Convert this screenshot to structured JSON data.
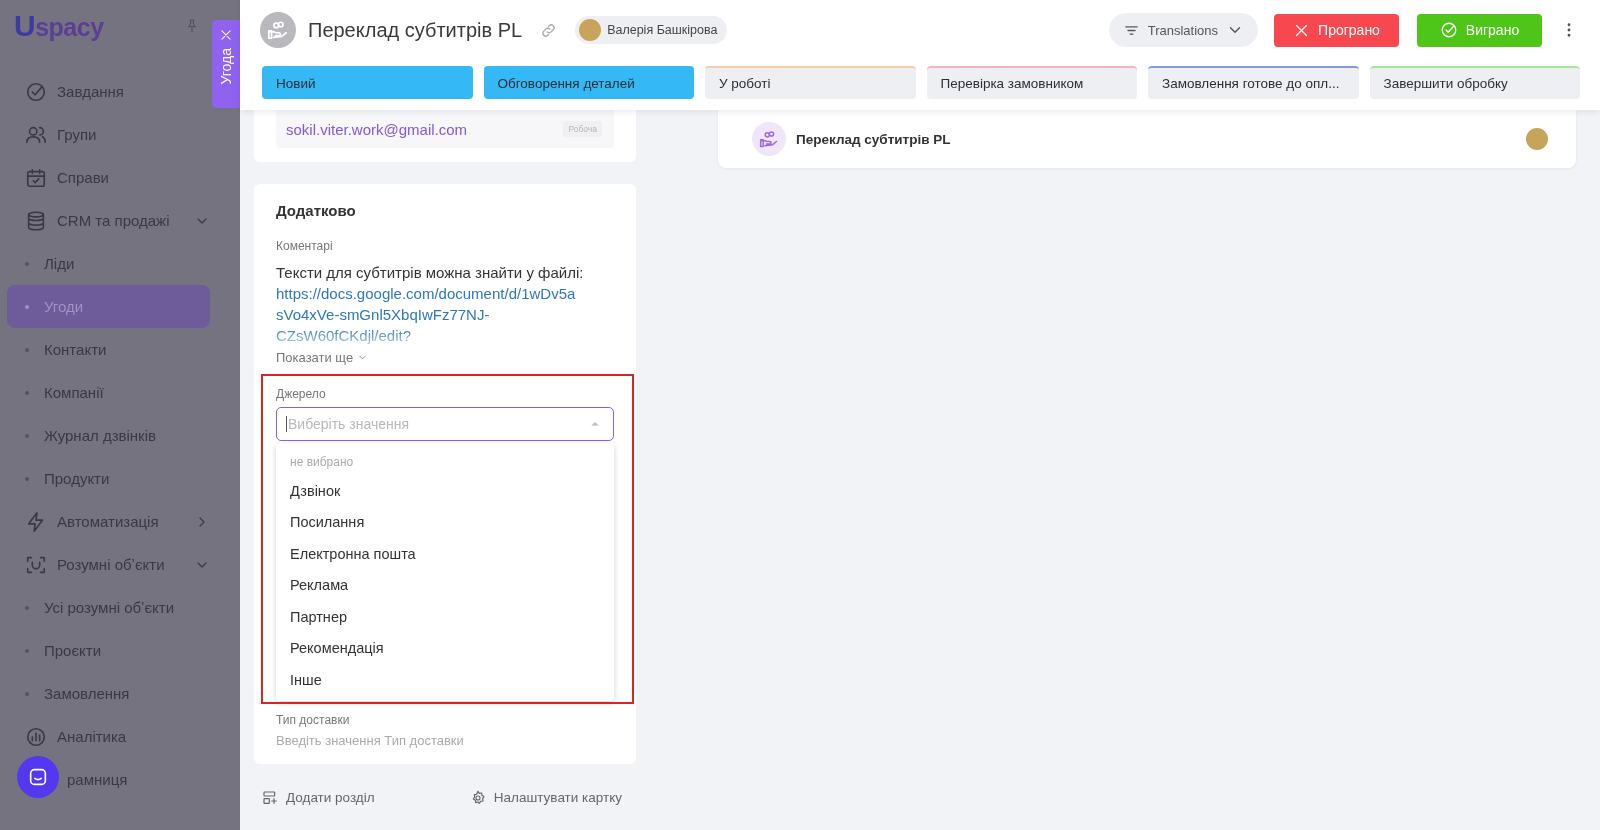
{
  "tab_handle": {
    "label": "Угода"
  },
  "sidebar": {
    "logo": "Uspacy",
    "items": [
      {
        "kind": "item",
        "label": "Завдання",
        "selected": false
      },
      {
        "kind": "item",
        "label": "Групи",
        "selected": false
      },
      {
        "kind": "item",
        "label": "Справи",
        "selected": false
      },
      {
        "kind": "group",
        "label": "CRM та продажі",
        "selected": false,
        "expanded": true,
        "children": [
          {
            "label": "Ліди",
            "selected": false
          },
          {
            "label": "Угоди",
            "selected": true
          },
          {
            "label": "Контакти",
            "selected": false
          },
          {
            "label": "Компанії",
            "selected": false
          },
          {
            "label": "Журнал дзвінків",
            "selected": false
          },
          {
            "label": "Продукти",
            "selected": false
          }
        ]
      },
      {
        "kind": "group",
        "label": "Автоматизація",
        "selected": false,
        "expanded": false
      },
      {
        "kind": "group",
        "label": "Розумні обʼєкти",
        "selected": false,
        "expanded": true,
        "children": [
          {
            "label": "Усі розумні обʼєкти",
            "selected": false
          },
          {
            "label": "Проєкти",
            "selected": false
          },
          {
            "label": "Замовлення",
            "selected": false
          }
        ]
      },
      {
        "kind": "item",
        "label": "Аналітика",
        "selected": false
      },
      {
        "kind": "partial",
        "label": "рамниця",
        "selected": false
      }
    ]
  },
  "header": {
    "title": "Переклад субтитрів PL",
    "responsible": "Валерія Башкірова",
    "pipeline": "Translations",
    "lose_button": "Програно",
    "win_button": "Виграно",
    "stages": [
      {
        "label": "Новий",
        "color": "#35b9f5",
        "done": true
      },
      {
        "label": "Обговорення деталей",
        "color": "#35b9f5",
        "done": true
      },
      {
        "label": "У роботі",
        "color": "#f5cba8",
        "done": false
      },
      {
        "label": "Перевірка замовником",
        "color": "#f2b5bd",
        "done": false
      },
      {
        "label": "Замовлення готове до опл...",
        "color": "#7f9fd6",
        "done": false
      },
      {
        "label": "Завершити обробку",
        "color": "#a8e6a0",
        "done": false
      }
    ]
  },
  "contact_card": {
    "email": "sokil.viter.work@gmail.com",
    "email_type": "Робоча"
  },
  "extra_card": {
    "title": "Додатково",
    "comment_label": "Коментарі",
    "comment_text": "Тексти для субтитрів можна знайти у файлі:",
    "comment_link": "https://docs.google.com/document/d/1wDv5asVo4xVe-smGnl5XbqIwFz77NJ-CZsW60fCKdjl/edit?",
    "show_more": "Показати ще",
    "source": {
      "label": "Джерело",
      "placeholder": "Виберіть значення",
      "expanded": true,
      "options": [
        {
          "kind": "empty",
          "label": "не вибрано",
          "selected": false
        },
        {
          "kind": "option",
          "label": "Дзвінок",
          "selected": false
        },
        {
          "kind": "option",
          "label": "Посилання",
          "selected": false
        },
        {
          "kind": "option",
          "label": "Електронна пошта",
          "selected": false
        },
        {
          "kind": "option",
          "label": "Реклама",
          "selected": false
        },
        {
          "kind": "option",
          "label": "Партнер",
          "selected": false
        },
        {
          "kind": "option",
          "label": "Рекомендація",
          "selected": false
        },
        {
          "kind": "option",
          "label": "Інше",
          "selected": false
        }
      ]
    },
    "delivery": {
      "label": "Тип доставки",
      "placeholder": "Введіть значення Тип доставки"
    }
  },
  "card_actions": [
    {
      "label": "Додати розділ"
    },
    {
      "label": "Налаштувати картку"
    }
  ],
  "linked_deal": {
    "title": "Переклад субтитрів PL"
  }
}
